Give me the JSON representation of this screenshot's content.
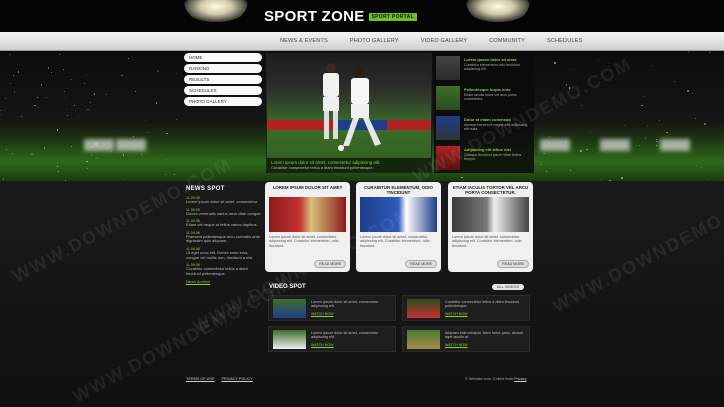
{
  "site": {
    "logo_text": "SPORT ZONE",
    "logo_badge": "SPORT PORTAL"
  },
  "nav": [
    "NEWS & EVENTS",
    "PHOTO GALLERY",
    "VIDEO GALLERY",
    "COMMUNITY",
    "SCHEDULES"
  ],
  "left_menu": [
    "HOME",
    "RANKING",
    "RESULTS",
    "SCHEDULES",
    "PHOTO GALLERY"
  ],
  "main_photo_caption": {
    "title": "Lorem ipsum dolor sit amet, consectetur adipiscing elit.",
    "text": "Curabitur consectetur tellus a diam tincidunt pellentesque."
  },
  "right_news": [
    {
      "title": "Lorem ipsum dolor sit amet",
      "text": "Curabitur elementum odio tincidunt adipiscing elit."
    },
    {
      "title": "Pellentesque turpis eros",
      "text": "Etiam iaculis tortor vel arcu porta consectetur."
    },
    {
      "title": "Dolor at etiam commodo",
      "text": "Aenean hendrerit magna sed adipiscing elit nulla."
    },
    {
      "title": "Adipiscing elit tellus nisi",
      "text": "Quisque tincidunt ipsum vitae lectus tempor."
    }
  ],
  "news_spot": {
    "heading": "NEWS SPOT",
    "items": [
      {
        "date": "11.09.08",
        "text": "Lorem ipsum dolor sit amet, consectetur."
      },
      {
        "date": "11.09.08",
        "text": "Donec venenatis varius urna vitae congue."
      },
      {
        "date": "11.09.08",
        "text": "Etiam vel neque ut tellus varius dapibus."
      },
      {
        "date": "11.09.08",
        "text": "Praesent pellentesque arcu convallis ante dignissim quis aliquam."
      },
      {
        "date": "11.09.08",
        "text": "Ut eget nunc elit. Donec enim eros, congue vel mollis non, tincidunt a nisi."
      },
      {
        "date": "11.09.08",
        "text": "Curabitur consectetur tellus a diam tincidunt pellentesque."
      }
    ],
    "more": "News Archive"
  },
  "features": [
    {
      "title": "LOREM IPSUM DOLOR SIT AMET",
      "text": "Lorem ipsum dolor sit amet, consectetur adipiscing elit. Curabitur elementum, odio tincidunt.",
      "button": "READ MORE"
    },
    {
      "title": "CURABITUR ELEMENTUM, ODIO TINCIDUNT",
      "text": "Lorem ipsum dolor sit amet, consectetur adipiscing elit. Curabitur elementum, odio tincidunt.",
      "button": "READ MORE"
    },
    {
      "title": "ETIAM IACULIS TORTOR VEL ARCU PORTA CONSECTETUR.",
      "text": "Lorem ipsum dolor sit amet, consectetur adipiscing elit. Curabitur elementum, odio tincidunt.",
      "button": "READ MORE"
    }
  ],
  "video_spot": {
    "heading": "VIDEO SPOT",
    "all_videos": "ALL VIDEOS",
    "items": [
      {
        "text": "Lorem ipsum dolor sit amet, consectetur adipiscing elit.",
        "watch": "WATCH NOW"
      },
      {
        "text": "Curabitur consectetur tellus a diam tincidunt pellentesque.",
        "watch": "WATCH NOW"
      },
      {
        "text": "Lorem ipsum dolor sit amet, consectetur adipiscing elit.",
        "watch": "WATCH NOW"
      },
      {
        "text": "Aliquam erat volutpat. Nam tortor justo, dictum eget iaculis at.",
        "watch": "WATCH NOW"
      }
    ]
  },
  "footer": {
    "links": [
      "TERMS OF USE",
      "PRIVACY POLICY"
    ],
    "copyright": "© Website.com. Collect from",
    "privacy_label": "Privacy"
  },
  "watermark": "WWW.DOWNDEMO.COM"
}
